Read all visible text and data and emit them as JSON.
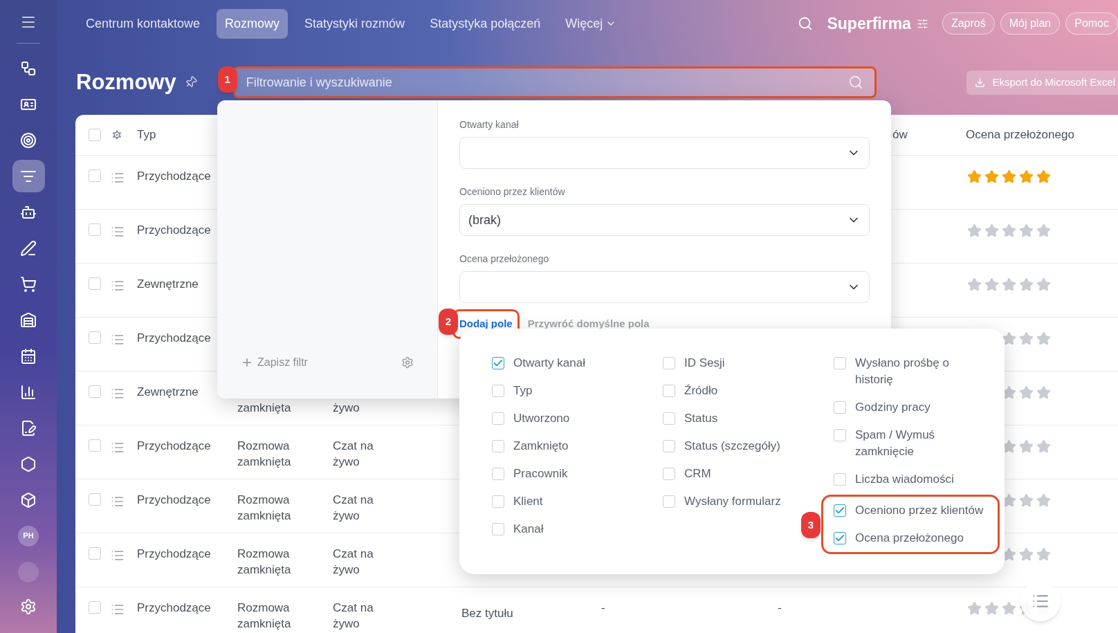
{
  "sidebar": {
    "items": [
      {
        "kind": "icon",
        "selected": false
      },
      {
        "kind": "icon",
        "selected": false
      },
      {
        "kind": "icon",
        "selected": false
      },
      {
        "kind": "icon",
        "selected": true
      },
      {
        "kind": "icon",
        "selected": false
      },
      {
        "kind": "icon",
        "selected": false
      },
      {
        "kind": "icon",
        "selected": false
      },
      {
        "kind": "icon",
        "selected": false
      },
      {
        "kind": "icon",
        "selected": false
      },
      {
        "kind": "icon",
        "selected": false
      },
      {
        "kind": "icon",
        "selected": false
      },
      {
        "kind": "icon",
        "selected": false
      },
      {
        "kind": "icon",
        "selected": false
      },
      {
        "kind": "avatar",
        "label": "PH",
        "selected": false
      },
      {
        "kind": "avatar",
        "selected": false
      }
    ]
  },
  "top_bar": {
    "tabs": [
      {
        "label": "Centrum kontaktowe",
        "selected": false,
        "kind": "link"
      },
      {
        "label": "Rozmowy",
        "selected": true,
        "kind": "link"
      },
      {
        "label": "Statystyki rozmów",
        "selected": false,
        "kind": "link"
      },
      {
        "label": "Statystyka połączeń",
        "selected": false,
        "kind": "link"
      },
      {
        "label": "Więcej",
        "selected": false,
        "kind": "dropdown"
      }
    ],
    "company": "Superfirma",
    "buttons": [
      "Zaproś",
      "Mój plan",
      "Pomoc"
    ]
  },
  "page": {
    "title": "Rozmowy",
    "search": {
      "placeholder": "Filtrowanie i wyszukiwanie",
      "badge": "1"
    },
    "export_button": "Eksport do Microsoft Excel"
  },
  "table": {
    "header_checked": false,
    "headers": {
      "column_1": "Typ",
      "column_7": "ów",
      "column_8": "Ocena przełożonego"
    },
    "rows": [
      {
        "checked": false,
        "type": "Przychodzące",
        "stars": 5
      },
      {
        "checked": false,
        "type": "Przychodzące",
        "stars": 0
      },
      {
        "checked": false,
        "type": "Zewnętrzne",
        "stars": 0
      },
      {
        "checked": false,
        "type": "Przychodzące",
        "stars": 0
      },
      {
        "checked": false,
        "type": "Zewnętrzne",
        "column_2": "zamknięta",
        "column_3": "żywo",
        "partly_covered": true,
        "stars": 0
      },
      {
        "checked": false,
        "type": "Przychodzące",
        "column_2": "Rozmowa zamknięta",
        "column_3": "Czat na żywo",
        "partly_covered": false,
        "stars": 0
      },
      {
        "checked": false,
        "type": "Przychodzące",
        "column_2": "Rozmowa zamknięta",
        "column_3": "Czat na żywo",
        "partly_covered": false,
        "stars": 0
      },
      {
        "checked": false,
        "type": "Przychodzące",
        "column_2": "Rozmowa zamknięta",
        "column_3": "Czat na żywo",
        "partly_covered": false,
        "stars": 0
      },
      {
        "checked": false,
        "type": "Przychodzące",
        "column_2": "Rozmowa zamknięta",
        "column_3": "Czat na żywo",
        "column_4": "Bez tytułu",
        "column_5": "-",
        "column_6": "-",
        "partly_covered": false,
        "stars": 0
      }
    ]
  },
  "filter_popup": {
    "save_filter": "Zapisz filtr",
    "fields": [
      {
        "label": "Otwarty kanał"
      },
      {
        "label": "Oceniono przez klientów",
        "value": "(brak)"
      },
      {
        "label": "Ocena przełożonego"
      }
    ],
    "add_field": {
      "label": "Dodaj pole",
      "badge": "2"
    },
    "restore_fields": "Przywróć domyślne pola"
  },
  "field_menu": {
    "badge": "3",
    "columns": [
      [
        {
          "label": "Otwarty kanał",
          "checked": true,
          "highlighted": false
        },
        {
          "label": "Typ",
          "checked": false,
          "highlighted": false
        },
        {
          "label": "Utworzono",
          "checked": false,
          "highlighted": false
        },
        {
          "label": "Zamknięto",
          "checked": false,
          "highlighted": false
        },
        {
          "label": "Pracownik",
          "checked": false,
          "highlighted": false
        },
        {
          "label": "Klient",
          "checked": false,
          "highlighted": false
        },
        {
          "label": "Kanał",
          "checked": false,
          "highlighted": false
        }
      ],
      [
        {
          "label": "ID Sesji",
          "checked": false,
          "highlighted": false
        },
        {
          "label": "Źródło",
          "checked": false,
          "highlighted": false
        },
        {
          "label": "Status",
          "checked": false,
          "highlighted": false
        },
        {
          "label": "Status (szczegóły)",
          "checked": false,
          "highlighted": false
        },
        {
          "label": "CRM",
          "checked": false,
          "highlighted": false
        },
        {
          "label": "Wysłany formularz",
          "checked": false,
          "highlighted": false
        }
      ],
      [
        {
          "label": "Wysłano prośbę o historię",
          "checked": false,
          "highlighted": false
        },
        {
          "label": "Godziny pracy",
          "checked": false,
          "highlighted": false
        },
        {
          "label": "Spam / Wymuś zamknięcie",
          "checked": false,
          "highlighted": false
        },
        {
          "label": "Liczba wiadomości",
          "checked": false,
          "highlighted": false
        },
        {
          "label": "Oceniono przez klientów",
          "checked": true,
          "highlighted": true
        },
        {
          "label": "Ocena przełożonego",
          "checked": true,
          "highlighted": true
        }
      ]
    ]
  }
}
